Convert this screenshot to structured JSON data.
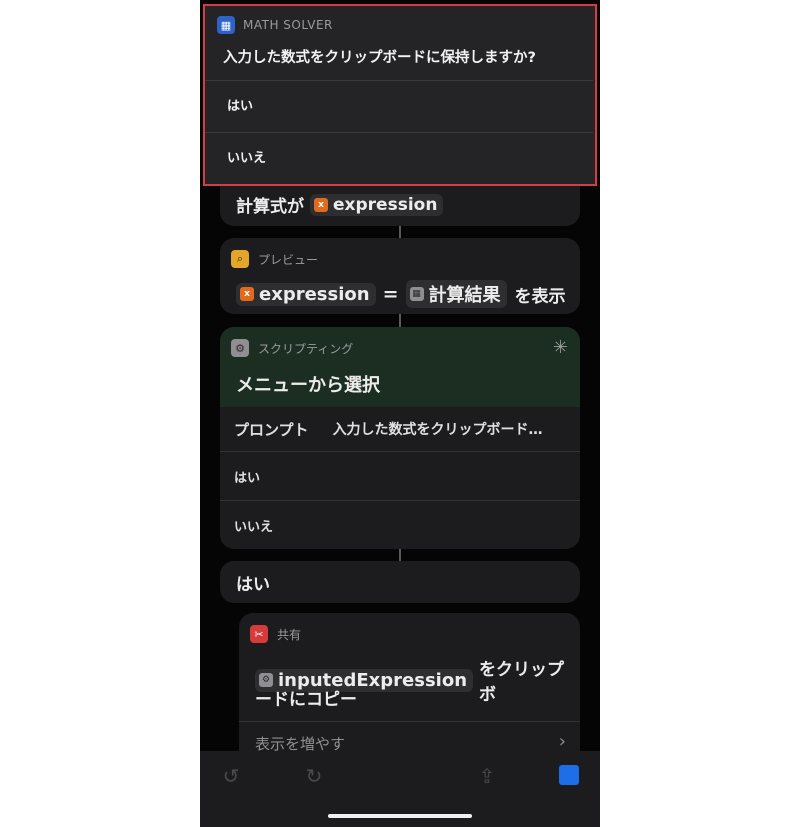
{
  "notification": {
    "app_name": "MATH SOLVER",
    "question": "入力した数式をクリップボードに保持しますか?",
    "options": [
      "はい",
      "いいえ"
    ]
  },
  "partial_card": {
    "label": "計算式が",
    "token": "expression"
  },
  "preview_card": {
    "header": "プレビュー",
    "token1": "expression",
    "equals": "=",
    "token2": "計算結果",
    "suffix": "を表示"
  },
  "scripting_card": {
    "header": "スクリプティング",
    "title": "メニューから選択",
    "prompt_label": "プロンプト",
    "prompt_value": "入力した数式をクリップボード…",
    "options": [
      "はい",
      "いいえ"
    ]
  },
  "yes_block": {
    "label": "はい"
  },
  "share_card": {
    "header": "共有",
    "token": "inputedExpression",
    "text_line1": "をクリップボ",
    "text_line2": "ードにコピー",
    "show_more": "表示を増やす"
  },
  "toolbar": {
    "undo_icon": "undo-icon",
    "redo_icon": "redo-icon",
    "share_icon": "share-icon",
    "stop_icon": "stop-icon"
  },
  "colors": {
    "accent_blue": "#1e6ee8",
    "highlight_red": "#d63b48",
    "running_green": "#1c2e22"
  }
}
